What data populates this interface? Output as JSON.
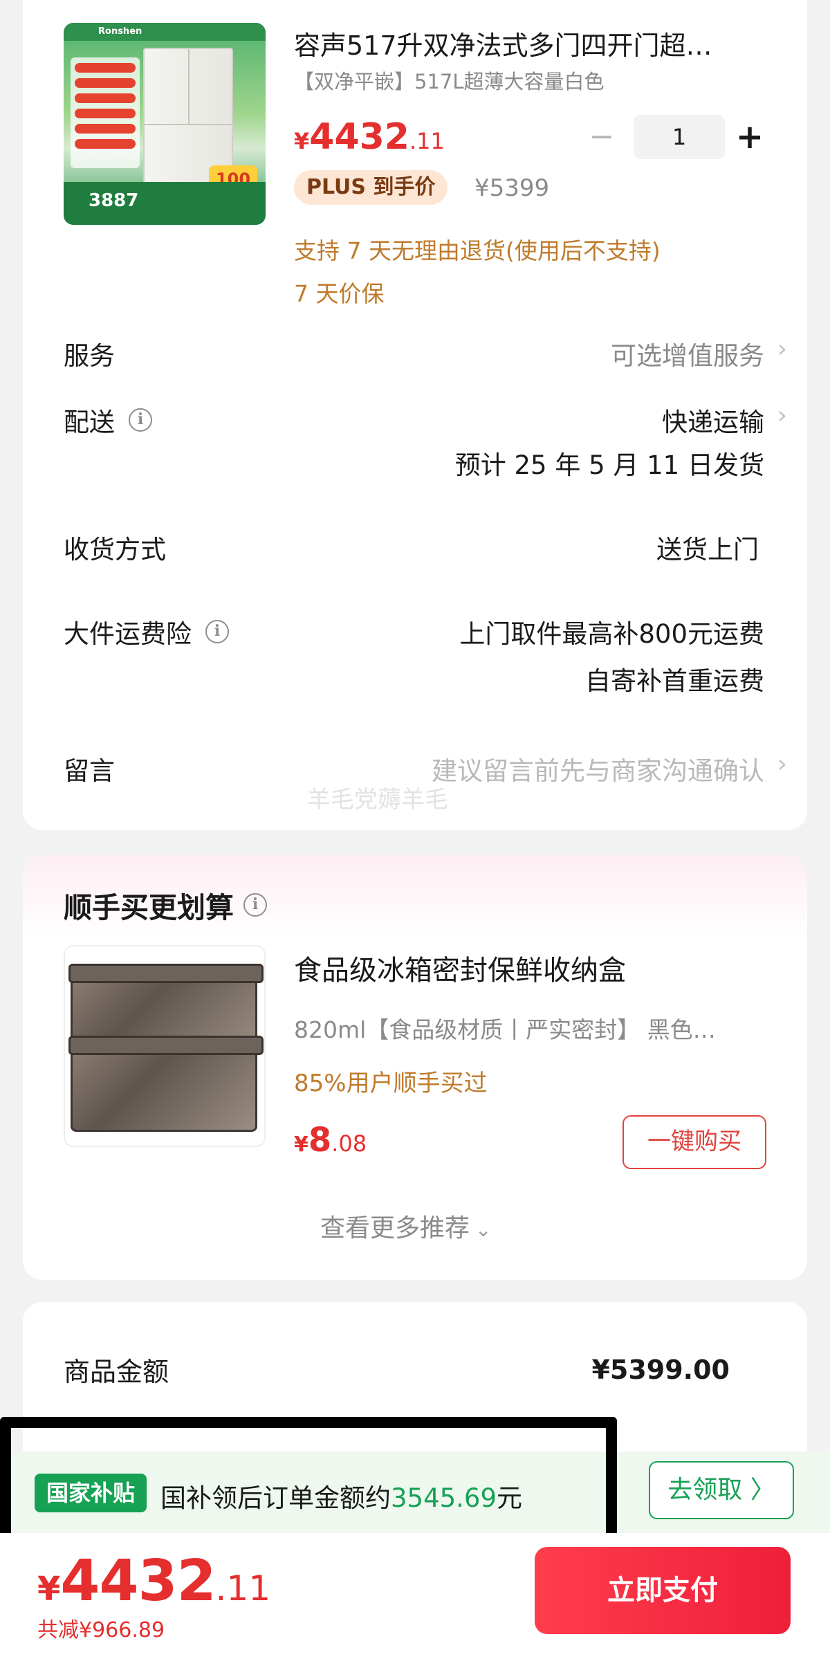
{
  "product": {
    "title": "容声517升双净法式多门四开门超…",
    "subtitle": "【双净平嵌】517L超薄大容量白色",
    "image": {
      "brand": "Ronshen",
      "price_strip": "3887",
      "badge": "100"
    },
    "price": {
      "symbol": "¥",
      "integer": "4432",
      "decimal": ".11"
    },
    "quantity": "1",
    "plus_badge": "PLUS 到手价",
    "original_price": "¥5399",
    "promo_return": "支持 7 天无理由退货(使用后不支持)",
    "promo_protect": "7 天价保"
  },
  "rows": {
    "service": {
      "label": "服务",
      "value": "可选增值服务"
    },
    "delivery": {
      "label": "配送",
      "value": "快递运输",
      "note": "预计 25 年 5 月 11 日发货"
    },
    "receive": {
      "label": "收货方式",
      "value": "送货上门"
    },
    "insurance": {
      "label": "大件运费险",
      "value1": "上门取件最高补800元运费",
      "value2": "自寄补首重运费"
    },
    "message": {
      "label": "留言",
      "placeholder": "建议留言前先与商家沟通确认"
    }
  },
  "watermark": "羊毛党薅羊毛",
  "recommend": {
    "title": "顺手买更划算",
    "item": {
      "name": "食品级冰箱密封保鲜收纳盒",
      "spec": "820ml【食品级材质丨严实密封】 黑色…",
      "stat": "85%用户顺手买过",
      "price": {
        "symbol": "¥",
        "integer": "8",
        "decimal": ".08"
      },
      "buy_label": "一键购买"
    },
    "more_label": "查看更多推荐"
  },
  "summary": {
    "label": "商品金额",
    "value": "¥5399.00"
  },
  "subsidy": {
    "tag": "国家补贴",
    "text_prefix": "国补领后订单金额约",
    "amount": "3545.69",
    "text_suffix": "元",
    "button": "去领取 〉"
  },
  "footer": {
    "total": {
      "symbol": "¥",
      "integer": "4432",
      "decimal": ".11"
    },
    "saved": "共减¥966.89",
    "pay_label": "立即支付"
  },
  "icons": {
    "info": "info-circle-icon",
    "chevron": "chevron-right-icon",
    "caret": "chevron-down-icon"
  },
  "colors": {
    "price_red": "#e52e2e",
    "promo_orange": "#c07a2b",
    "subsidy_green": "#17a155",
    "pay_gradient_start": "#ff3d4c",
    "pay_gradient_end": "#ef1f3a"
  }
}
